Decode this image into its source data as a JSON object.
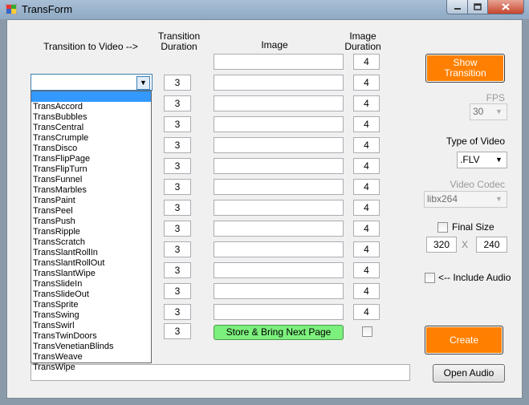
{
  "window": {
    "title": "TransForm"
  },
  "headers": {
    "transition_to_video": "Transition to Video -->",
    "transition_duration": "Transition\nDuration",
    "image": "Image",
    "image_duration": "Image\nDuration"
  },
  "first_image_duration": "4",
  "rows": [
    {
      "transition_duration": "3",
      "image": "",
      "image_duration": "4"
    },
    {
      "transition_duration": "3",
      "image": "",
      "image_duration": "4"
    },
    {
      "transition_duration": "3",
      "image": "",
      "image_duration": "4"
    },
    {
      "transition_duration": "3",
      "image": "",
      "image_duration": "4"
    },
    {
      "transition_duration": "3",
      "image": "",
      "image_duration": "4"
    },
    {
      "transition_duration": "3",
      "image": "",
      "image_duration": "4"
    },
    {
      "transition_duration": "3",
      "image": "",
      "image_duration": "4"
    },
    {
      "transition_duration": "3",
      "image": "",
      "image_duration": "4"
    },
    {
      "transition_duration": "3",
      "image": "",
      "image_duration": "4"
    },
    {
      "transition_duration": "3",
      "image": "",
      "image_duration": "4"
    },
    {
      "transition_duration": "3",
      "image": "",
      "image_duration": "4"
    },
    {
      "transition_duration": "3",
      "image": "",
      "image_duration": "4"
    }
  ],
  "last_transition_duration": "3",
  "store_button": "Store & Bring Next Page",
  "transition_list": [
    "TransAccord",
    "TransBubbles",
    "TransCentral",
    "TransCrumple",
    "TransDisco",
    "TransFlipPage",
    "TransFlipTurn",
    "TransFunnel",
    "TransMarbles",
    "TransPaint",
    "TransPeel",
    "TransPush",
    "TransRipple",
    "TransScratch",
    "TransSlantRollIn",
    "TransSlantRollOut",
    "TransSlantWipe",
    "TransSlideIn",
    "TransSlideOut",
    "TransSprite",
    "TransSwing",
    "TransSwirl",
    "TransTwinDoors",
    "TransVenetianBlinds",
    "TransWeave",
    "TransWipe"
  ],
  "right_panel": {
    "show_transition": "Show\nTransition",
    "fps_label": "FPS",
    "fps_value": "30",
    "type_of_video_label": "Type of Video",
    "type_of_video_value": ".FLV",
    "video_codec_label": "Video Codec",
    "video_codec_value": "libx264",
    "final_size_label": "Final Size",
    "width": "320",
    "x_sep": "X",
    "height": "240",
    "include_audio_label": "<-- Include Audio",
    "create": "Create",
    "open_audio": "Open Audio"
  },
  "audio_path": "",
  "colors": {
    "accent_orange": "#ff8000",
    "store_green": "#7cf07c",
    "selection": "#3399ff"
  }
}
